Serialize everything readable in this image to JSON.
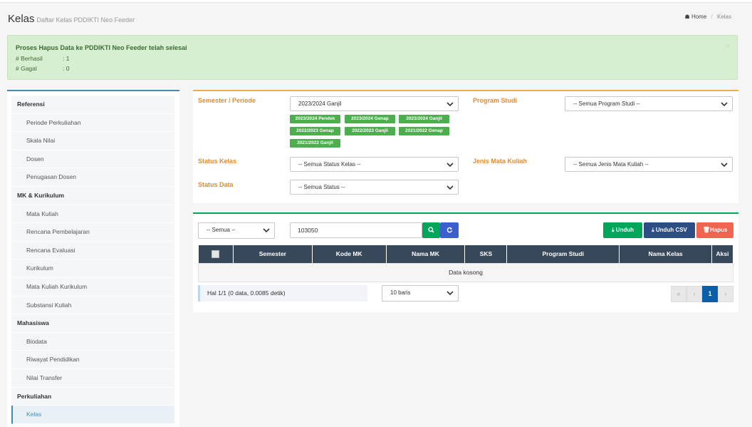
{
  "page": {
    "title": "Kelas",
    "subtitle": "Daftar Kelas PDDIKTI Neo Feeder"
  },
  "breadcrumb": {
    "home": "Home",
    "current": "Kelas"
  },
  "alert": {
    "heading": "Proses Hapus Data ke PDDIKTI Neo Feeder telah selesai",
    "rows": [
      {
        "label": "# Berhasil",
        "value": ": 1"
      },
      {
        "label": "# Gagal",
        "value": ": 0"
      }
    ],
    "close": "×"
  },
  "sidebar": {
    "items": [
      {
        "label": "Referensi",
        "type": "head"
      },
      {
        "label": "Periode Perkuliahan",
        "type": "sub"
      },
      {
        "label": "Skala Nilai",
        "type": "sub"
      },
      {
        "label": "Dosen",
        "type": "sub"
      },
      {
        "label": "Penugasan Dosen",
        "type": "sub"
      },
      {
        "label": "MK & Kurikulum",
        "type": "head"
      },
      {
        "label": "Mata Kuliah",
        "type": "sub"
      },
      {
        "label": "Rencana Pembelajaran",
        "type": "sub"
      },
      {
        "label": "Rencana Evaluasi",
        "type": "sub"
      },
      {
        "label": "Kurikulum",
        "type": "sub"
      },
      {
        "label": "Mata Kuliah Kurikulum",
        "type": "sub"
      },
      {
        "label": "Substansi Kuliah",
        "type": "sub"
      },
      {
        "label": "Mahasiswa",
        "type": "head"
      },
      {
        "label": "Biodata",
        "type": "sub"
      },
      {
        "label": "Riwayat Pendidikan",
        "type": "sub"
      },
      {
        "label": "Nilai Transfer",
        "type": "sub"
      },
      {
        "label": "Perkuliahan",
        "type": "head"
      },
      {
        "label": "Kelas",
        "type": "active"
      }
    ]
  },
  "filters": {
    "semester_label": "Semester / Periode",
    "semester_value": "2023/2024 Ganjil",
    "semester_tags": [
      "2023/2024 Pendek",
      "2023/2024 Genap",
      "2023/2024 Ganjil",
      "2022/2023 Genap",
      "2022/2023 Ganjil",
      "2021/2022 Genap",
      "2021/2022 Ganjil"
    ],
    "prodi_label": "Program Studi",
    "prodi_value": "-- Semua Program Studi --",
    "status_kelas_label": "Status Kelas",
    "status_kelas_value": "-- Semua Status Kelas --",
    "jenis_mk_label": "Jenis Mata Kuliah",
    "jenis_mk_value": "-- Semua Jenis Mata Kuliah --",
    "status_data_label": "Status Data",
    "status_data_value": "-- Semua Status --"
  },
  "toolbar": {
    "scope_value": "-- Semua --",
    "search_value": "103050",
    "unduh": "Unduh",
    "unduh_csv": "Unduh CSV",
    "hapus": "Hapus"
  },
  "table": {
    "columns": [
      "Semester",
      "Kode MK",
      "Nama MK",
      "SKS",
      "Program Studi",
      "Nama Kelas",
      "Aksi"
    ],
    "empty": "Data kosong"
  },
  "footer": {
    "info": "Hal 1/1 (0 data, 0.0085 detik)",
    "page_size": "10 baris",
    "first": "«",
    "prev": "‹",
    "page": "1",
    "next": "›"
  },
  "colors": {
    "accent": "#3c8dbc",
    "header_dark": "#37485a",
    "success": "#00a65a",
    "warning": "#e08c31",
    "danger": "#f0654f"
  }
}
